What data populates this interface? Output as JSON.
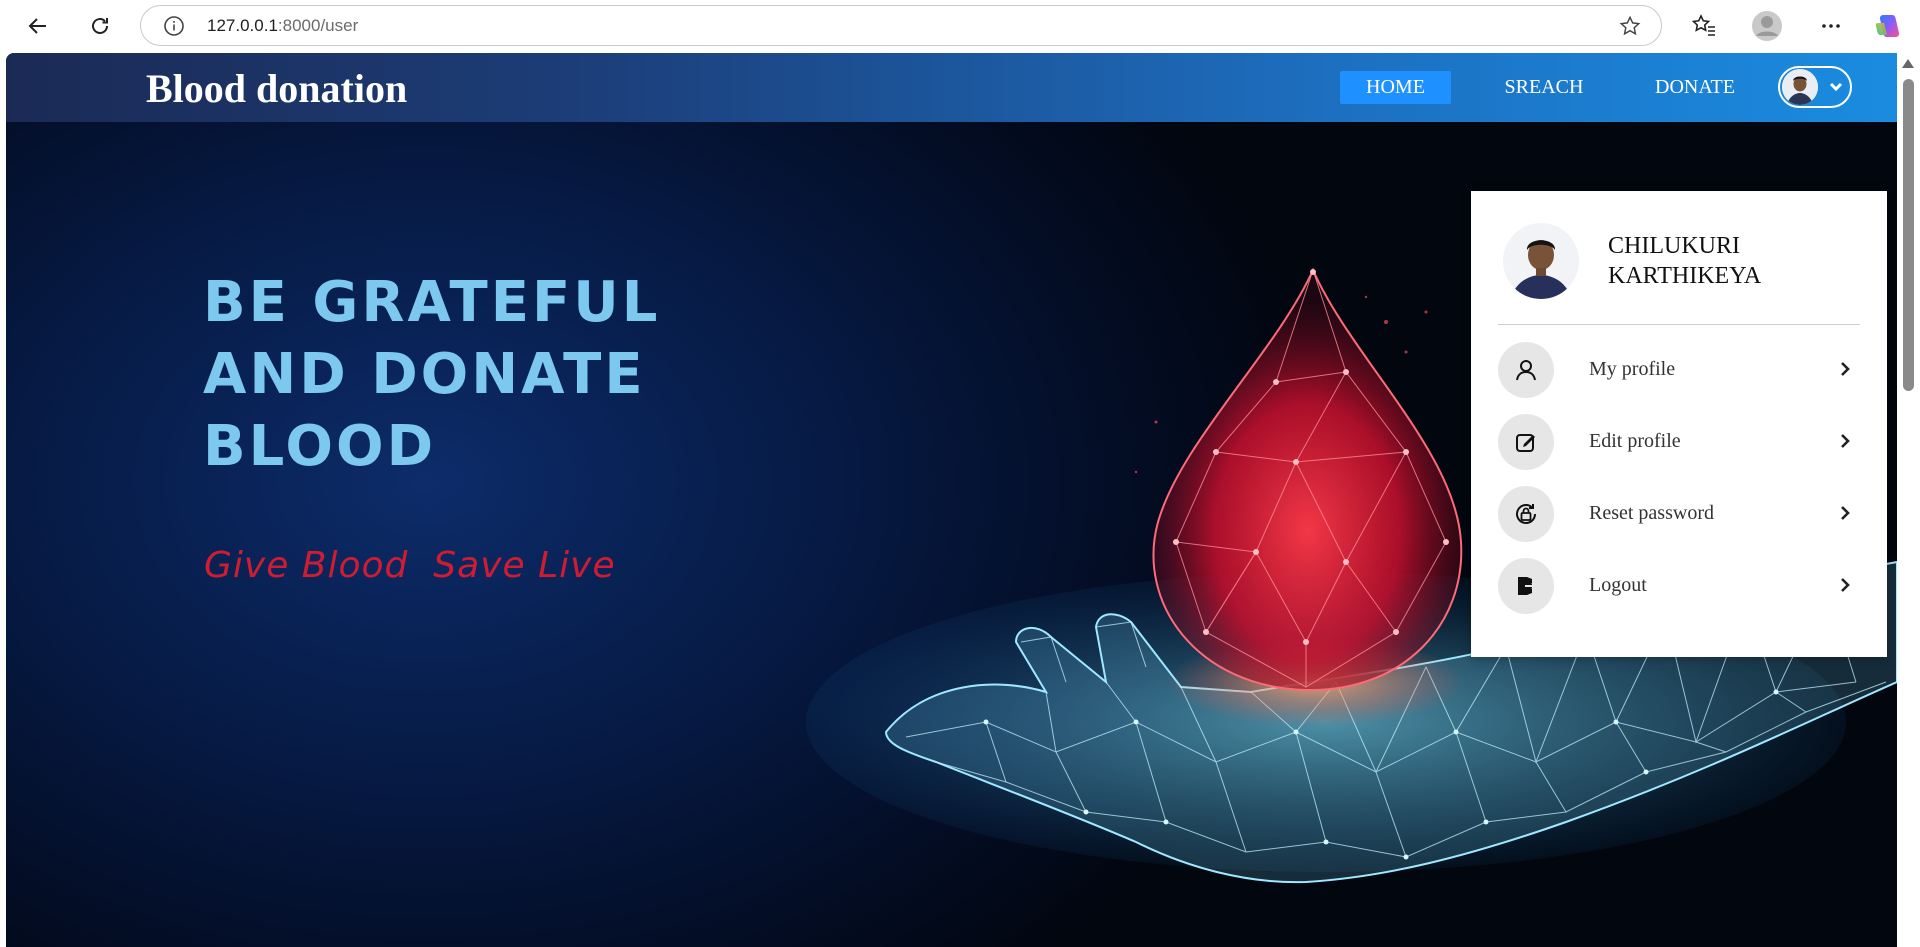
{
  "browser": {
    "url_host": "127.0.0.1",
    "url_path": ":8000/user",
    "icons": [
      "back-icon",
      "reload-icon",
      "info-icon",
      "star-icon",
      "favorites-icon",
      "profile-icon",
      "more-icon",
      "copilot-icon"
    ]
  },
  "navbar": {
    "brand": "Blood donation",
    "links": [
      {
        "label": "HOME",
        "active": true
      },
      {
        "label": "SREACH",
        "active": false
      },
      {
        "label": "DONATE",
        "active": false
      }
    ]
  },
  "hero": {
    "headline": [
      "BE GRATEFUL",
      "AND DONATE",
      "BLOOD"
    ],
    "tagline": "Give Blood  Save Live"
  },
  "user_menu": {
    "name_line1": "CHILUKURI",
    "name_line2": "KARTHIKEYA",
    "items": [
      {
        "label": "My profile",
        "icon": "user-icon"
      },
      {
        "label": "Edit profile",
        "icon": "edit-icon"
      },
      {
        "label": "Reset password",
        "icon": "lock-reset-icon"
      },
      {
        "label": "Logout",
        "icon": "logout-icon"
      }
    ]
  },
  "colors": {
    "nav_active": "#1e90ff",
    "headline": "#7cc8ee",
    "tagline": "#d01c32"
  }
}
